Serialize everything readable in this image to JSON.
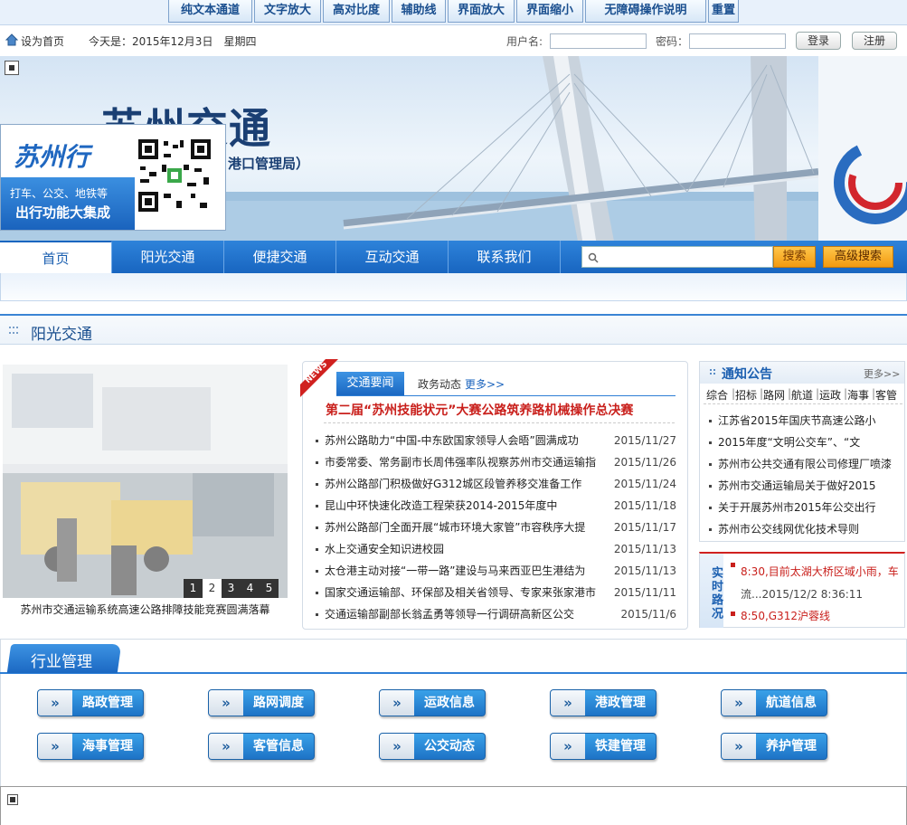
{
  "toolbar": {
    "items": [
      "纯文本通道",
      "文字放大",
      "高对比度",
      "辅助线",
      "界面放大",
      "界面缩小",
      "无障碍操作说明",
      "重置"
    ]
  },
  "infobar": {
    "home": "设为首页",
    "date": "今天是：2015年12月3日　星期四",
    "user_label": "用户名:",
    "pwd_label": "密码：",
    "login": "登录",
    "register": "注册"
  },
  "banner": {
    "logo_text": "苏州交通",
    "sub_text": "港口管理局）",
    "ad_title": "苏州行",
    "ad_line1": "打车、公交、地铁等",
    "ad_line2": "出行功能大集成"
  },
  "nav": {
    "items": [
      "首页",
      "阳光交通",
      "便捷交通",
      "互动交通",
      "联系我们"
    ],
    "search_btn": "搜索",
    "adv_search": "高级搜索"
  },
  "section": {
    "title": "阳光交通"
  },
  "photo": {
    "caption": "苏州市交通运输系统高速公路排障技能竞赛圆满落幕",
    "pages": [
      "1",
      "2",
      "3",
      "4",
      "5"
    ]
  },
  "news": {
    "badge": "NEWS",
    "tab_active": "交通要闻",
    "tab2": "政务动态",
    "more": "更多>>",
    "headline": "第二届“苏州技能状元”大赛公路筑养路机械操作总决赛",
    "items": [
      {
        "title": "苏州公路助力“中国-中东欧国家领导人会晤”圆满成功",
        "date": "2015/11/27"
      },
      {
        "title": "市委常委、常务副市长周伟强率队视察苏州市交通运输指",
        "date": "2015/11/26"
      },
      {
        "title": "苏州公路部门积极做好G312城区段管养移交准备工作",
        "date": "2015/11/24"
      },
      {
        "title": "昆山中环快速化改造工程荣获2014-2015年度中",
        "date": "2015/11/18"
      },
      {
        "title": "苏州公路部门全面开展“城市环境大家管”市容秩序大提",
        "date": "2015/11/17"
      },
      {
        "title": "水上交通安全知识进校园",
        "date": "2015/11/13"
      },
      {
        "title": "太仓港主动对接“一带一路”建设与马来西亚巴生港结为",
        "date": "2015/11/13"
      },
      {
        "title": "国家交通运输部、环保部及相关省领导、专家来张家港市",
        "date": "2015/11/11"
      },
      {
        "title": "交通运输部副部长翁孟勇等领导一行调研高新区公交",
        "date": "2015/11/6"
      }
    ]
  },
  "notice": {
    "title": "通知公告",
    "more": "更多>>",
    "cats": [
      "综合",
      "招标",
      "路网",
      "航道",
      "运政",
      "海事",
      "客管"
    ],
    "items": [
      "江苏省2015年国庆节高速公路小",
      "2015年度“文明公交车”、“文",
      "苏州市公共交通有限公司修理厂喷漆",
      "苏州市交通运输局关于做好2015",
      "关于开展苏州市2015年公交出行",
      "苏州市公交线网优化技术导则"
    ]
  },
  "traffic": {
    "label": "实时路况",
    "line1": "8:30,目前太湖大桥区域小雨，车",
    "line2": "流...2015/12/2 8:36:11",
    "line3": "8:50,G312沪蓉线"
  },
  "industry": {
    "title": "行业管理",
    "arrow": "»",
    "items": [
      "路政管理",
      "路网调度",
      "运政信息",
      "港政管理",
      "航道信息",
      "海事管理",
      "客管信息",
      "公交动态",
      "铁建管理",
      "养护管理"
    ]
  }
}
